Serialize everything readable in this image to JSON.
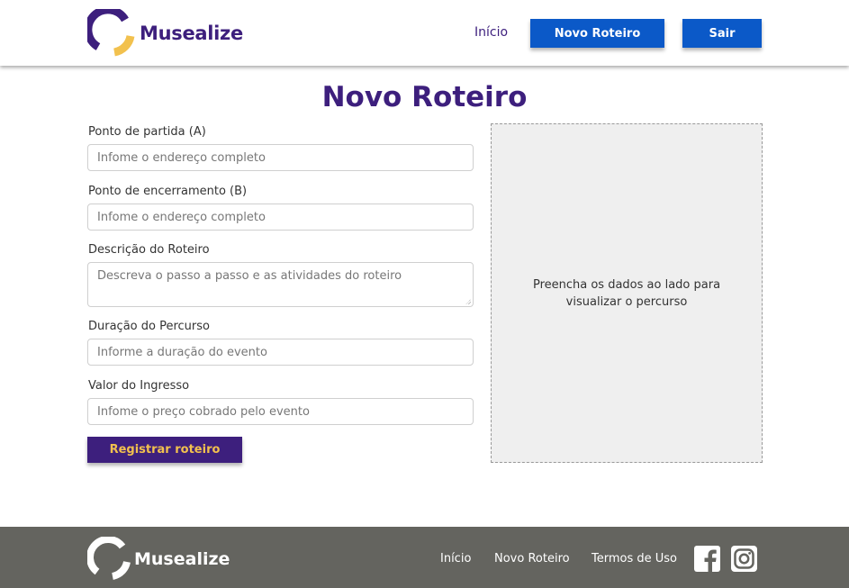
{
  "header": {
    "brand": "Musealize",
    "nav_home": "Início",
    "btn_new_route": "Novo Roteiro",
    "btn_logout": "Sair"
  },
  "main": {
    "title": "Novo Roteiro",
    "fields": [
      {
        "label": "Ponto de partida (A)",
        "placeholder": "Infome o endereço completo"
      },
      {
        "label": "Ponto de encerramento (B)",
        "placeholder": "Infome o endereço completo"
      },
      {
        "label": "Descrição do Roteiro",
        "placeholder": "Descreva o passo a passo e as atividades do roteiro"
      },
      {
        "label": "Duração do Percurso",
        "placeholder": "Informe a duração do evento"
      },
      {
        "label": "Valor do Ingresso",
        "placeholder": "Infome o preço cobrado pelo evento"
      }
    ],
    "submit": "Registrar roteiro",
    "map_message": "Preencha os dados ao lado para visualizar o percurso"
  },
  "footer": {
    "brand": "Musealize",
    "links": [
      "Início",
      "Novo Roteiro",
      "Termos de Uso"
    ],
    "social": [
      "facebook-icon",
      "instagram-icon"
    ]
  },
  "colors": {
    "primary": "#3d1f7d",
    "accent": "#f2c14e",
    "button_blue": "#0b59c8",
    "footer_bg": "#64645f"
  }
}
